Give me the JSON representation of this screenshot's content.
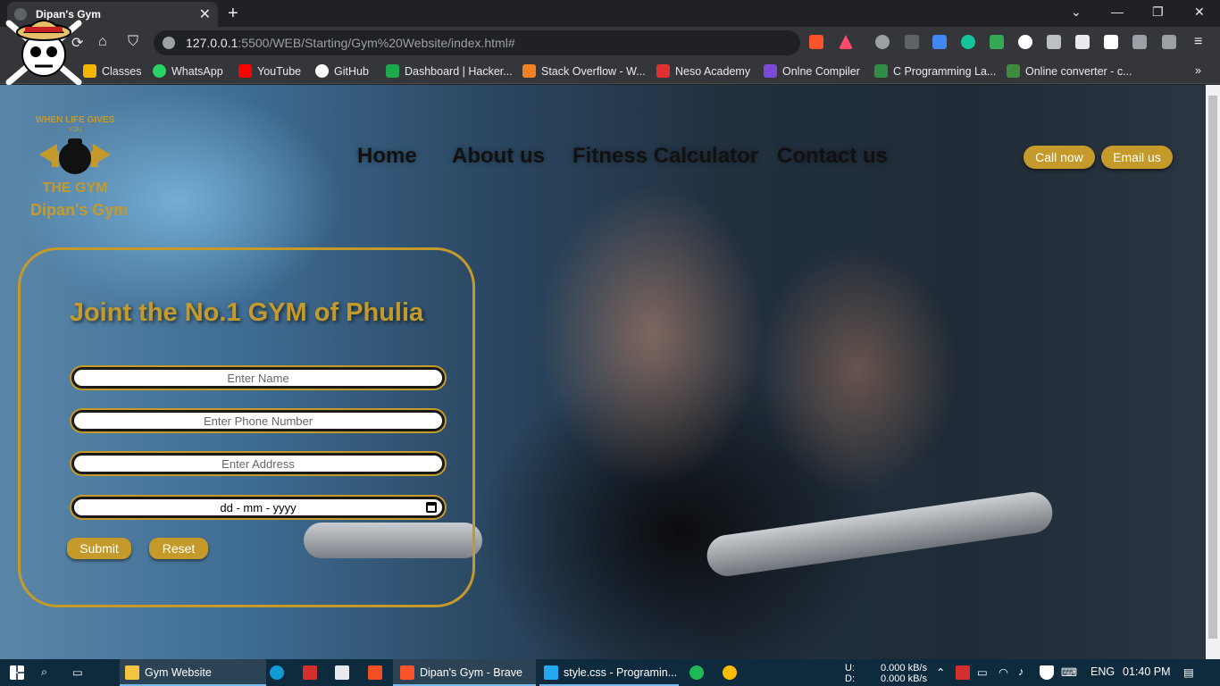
{
  "browser": {
    "tab_title": "Dipan's Gym",
    "tab_close": "✕",
    "new_tab": "+",
    "url_host": "127.0.0.1",
    "url_path": ":5500/WEB/Starting/Gym%20Website/index.html#",
    "win_min": "—",
    "win_restore": "❐",
    "win_close": "✕",
    "win_chevron": "⌄"
  },
  "bookmarks": [
    {
      "label": "Classes",
      "icon": "classroom-icon",
      "color": "#f4b400"
    },
    {
      "label": "WhatsApp",
      "icon": "whatsapp-icon",
      "color": "#25d366"
    },
    {
      "label": "YouTube",
      "icon": "youtube-icon",
      "color": "#ff0000"
    },
    {
      "label": "GitHub",
      "icon": "github-icon",
      "color": "#ffffff"
    },
    {
      "label": "Dashboard | Hacker...",
      "icon": "hackerrank-icon",
      "color": "#1ba94c"
    },
    {
      "label": "Stack Overflow - W...",
      "icon": "stackoverflow-icon",
      "color": "#f48024"
    },
    {
      "label": "Neso Academy",
      "icon": "neso-icon",
      "color": "#e03030"
    },
    {
      "label": "Onlne Compiler",
      "icon": "compiler-icon",
      "color": "#7b4bd8"
    },
    {
      "label": "C Programming La...",
      "icon": "geeks-icon",
      "color": "#2f8d46"
    },
    {
      "label": "Online converter - c...",
      "icon": "converter-icon",
      "color": "#3d8b3d"
    }
  ],
  "site": {
    "brand": "Dipan's Gym",
    "nav": [
      "Home",
      "About us",
      "Fitness Calculator",
      "Contact us"
    ],
    "call_button": "Call now",
    "email_button": "Email us",
    "form_title": "Joint the No.1 GYM of Phulia",
    "name_placeholder": "Enter Name",
    "phone_placeholder": "Enter Phone Number",
    "address_placeholder": "Enter Address",
    "date_placeholder": "dd - mm - yyyy",
    "submit": "Submit",
    "reset": "Reset",
    "logo_text_top": "WHEN LIFE GIVES",
    "logo_text_you": "YOU",
    "logo_text_bottom": "THE GYM",
    "accent_color": "#c49a2a"
  },
  "taskbar": {
    "items": [
      {
        "label": "Gym Website",
        "icon": "folder-icon"
      },
      {
        "label": "Dipan's Gym - Brave",
        "icon": "brave-icon"
      },
      {
        "label": "style.css - Programin...",
        "icon": "vscode-icon"
      }
    ],
    "net_up_label": "U:",
    "net_down_label": "D:",
    "net_up": "0.000 kB/s",
    "net_down": "0.000 kB/s",
    "lang": "ENG",
    "time": "01:40 PM"
  }
}
